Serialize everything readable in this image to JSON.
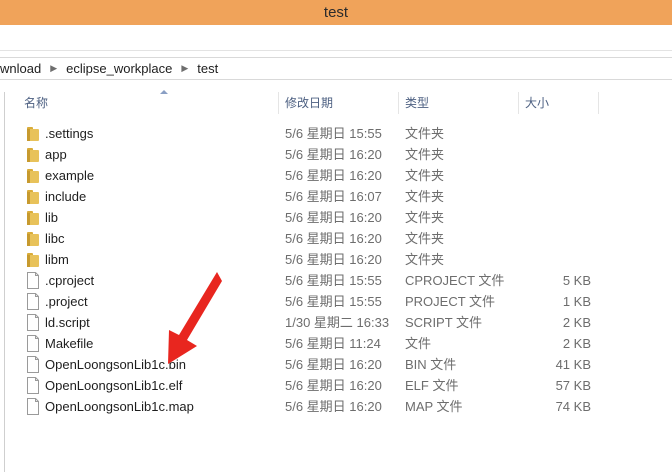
{
  "window": {
    "title": "test"
  },
  "breadcrumb": [
    "wnload",
    "eclipse_workplace",
    "test"
  ],
  "columns": {
    "name": "名称",
    "date": "修改日期",
    "type": "类型",
    "size": "大小"
  },
  "files": [
    {
      "name": ".settings",
      "date": "5/6 星期日 15:55",
      "type": "文件夹",
      "size": "",
      "kind": "folder"
    },
    {
      "name": "app",
      "date": "5/6 星期日 16:20",
      "type": "文件夹",
      "size": "",
      "kind": "folder"
    },
    {
      "name": "example",
      "date": "5/6 星期日 16:20",
      "type": "文件夹",
      "size": "",
      "kind": "folder"
    },
    {
      "name": "include",
      "date": "5/6 星期日 16:07",
      "type": "文件夹",
      "size": "",
      "kind": "folder"
    },
    {
      "name": "lib",
      "date": "5/6 星期日 16:20",
      "type": "文件夹",
      "size": "",
      "kind": "folder"
    },
    {
      "name": "libc",
      "date": "5/6 星期日 16:20",
      "type": "文件夹",
      "size": "",
      "kind": "folder"
    },
    {
      "name": "libm",
      "date": "5/6 星期日 16:20",
      "type": "文件夹",
      "size": "",
      "kind": "folder"
    },
    {
      "name": ".cproject",
      "date": "5/6 星期日 15:55",
      "type": "CPROJECT 文件",
      "size": "5 KB",
      "kind": "file"
    },
    {
      "name": ".project",
      "date": "5/6 星期日 15:55",
      "type": "PROJECT 文件",
      "size": "1 KB",
      "kind": "file"
    },
    {
      "name": "ld.script",
      "date": "1/30 星期二 16:33",
      "type": "SCRIPT 文件",
      "size": "2 KB",
      "kind": "file"
    },
    {
      "name": "Makefile",
      "date": "5/6 星期日 11:24",
      "type": "文件",
      "size": "2 KB",
      "kind": "file"
    },
    {
      "name": "OpenLoongsonLib1c.bin",
      "date": "5/6 星期日 16:20",
      "type": "BIN 文件",
      "size": "41 KB",
      "kind": "file"
    },
    {
      "name": "OpenLoongsonLib1c.elf",
      "date": "5/6 星期日 16:20",
      "type": "ELF 文件",
      "size": "57 KB",
      "kind": "file"
    },
    {
      "name": "OpenLoongsonLib1c.map",
      "date": "5/6 星期日 16:20",
      "type": "MAP 文件",
      "size": "74 KB",
      "kind": "file"
    }
  ],
  "annotation": {
    "color": "#e8261f",
    "points_to": "OpenLoongsonLib1c.bin"
  },
  "colors": {
    "titlebar": "#f0a35a",
    "folder": "#e8c25a",
    "header_text": "#4d6082"
  }
}
